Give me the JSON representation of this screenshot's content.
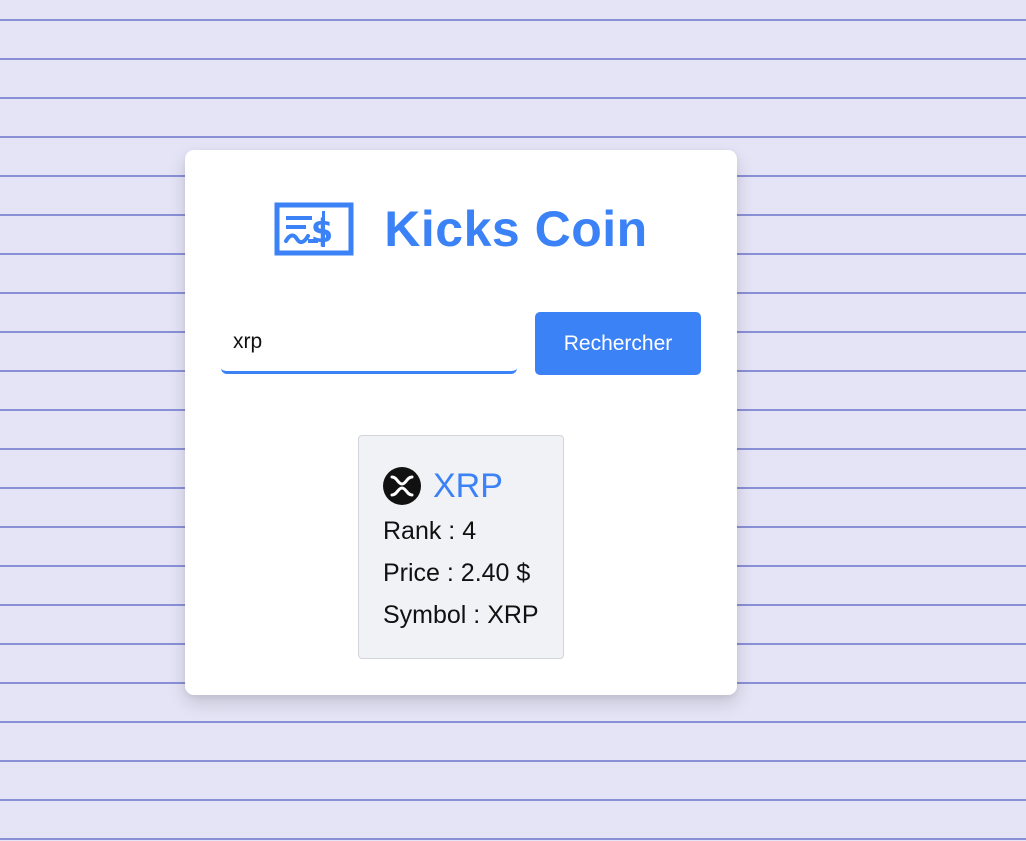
{
  "app": {
    "title": "Kicks Coin",
    "brand_icon": "cheque-dollar-icon"
  },
  "search": {
    "value": "xrp",
    "placeholder": "",
    "button_label": "Rechercher"
  },
  "result": {
    "icon": "xrp-logo-icon",
    "name": "XRP",
    "rank_label": "Rank : 4",
    "price_label": "Price : 2.40 $",
    "symbol_label": "Symbol : XRP"
  },
  "colors": {
    "accent": "#3b82f6",
    "background": "#e4e4f6",
    "lines": "#8a90d6"
  }
}
